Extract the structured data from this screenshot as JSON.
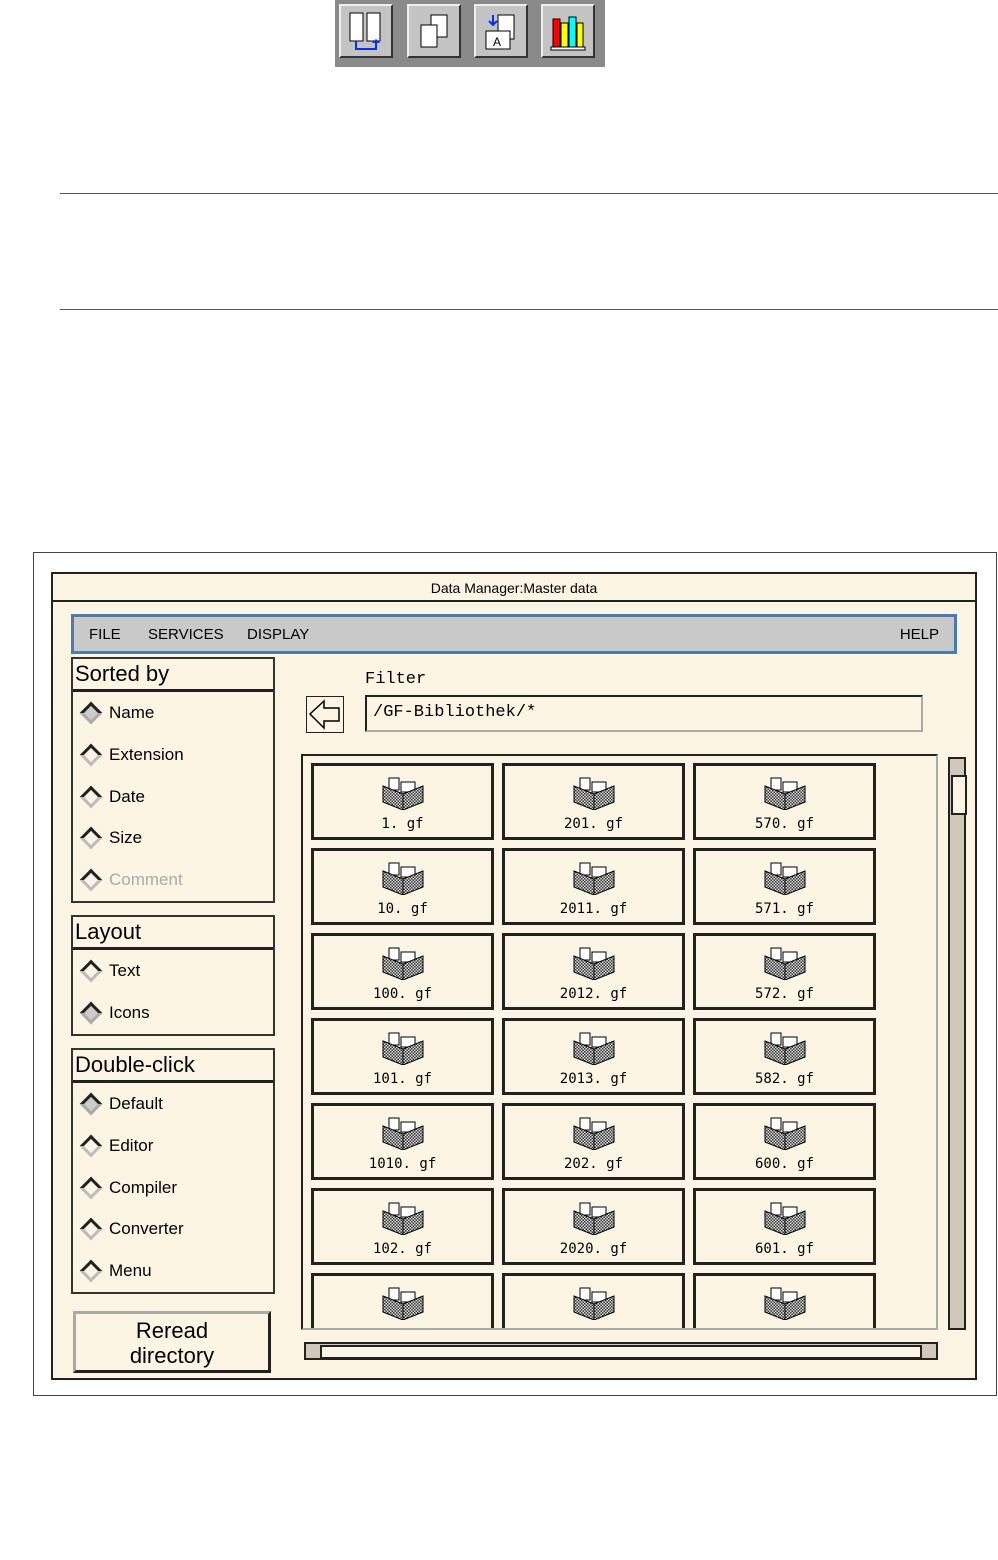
{
  "toolbar": {
    "buttons": [
      "split-view-icon",
      "copy-pages-icon",
      "replace-document-icon",
      "library-books-icon"
    ]
  },
  "window": {
    "title": "Data Manager:Master data"
  },
  "menu": {
    "file": "FILE",
    "services": "SERVICES",
    "display": "DISPLAY",
    "help": "HELP"
  },
  "sorted_by": {
    "title": "Sorted by",
    "items": [
      {
        "label": "Name",
        "selected": true
      },
      {
        "label": "Extension"
      },
      {
        "label": "Date"
      },
      {
        "label": "Size"
      },
      {
        "label": "Comment",
        "disabled": true
      }
    ]
  },
  "layout": {
    "title": "Layout",
    "items": [
      {
        "label": "Text"
      },
      {
        "label": "Icons",
        "selected": true
      }
    ]
  },
  "double_click": {
    "title": "Double-click",
    "items": [
      {
        "label": "Default",
        "selected": true
      },
      {
        "label": "Editor"
      },
      {
        "label": "Compiler"
      },
      {
        "label": "Converter"
      },
      {
        "label": "Menu"
      }
    ]
  },
  "reread_button": "Reread directory",
  "filter": {
    "label": "Filter",
    "value": "/GF-Bibliothek/*"
  },
  "files": [
    "1. gf",
    "201. gf",
    "570. gf",
    "10. gf",
    "2011. gf",
    "571. gf",
    "100. gf",
    "2012. gf",
    "572. gf",
    "101. gf",
    "2013. gf",
    "582. gf",
    "1010. gf",
    "202. gf",
    "600. gf",
    "102. gf",
    "2020. gf",
    "601. gf",
    "",
    "",
    ""
  ]
}
